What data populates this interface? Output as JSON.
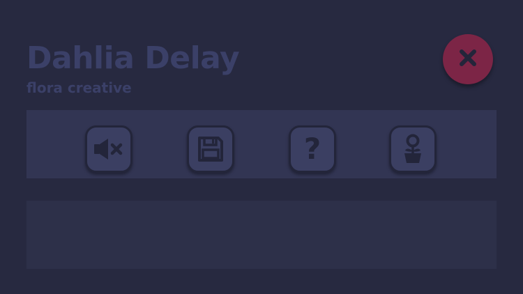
{
  "header": {
    "title": "Dahlia Delay",
    "subtitle": "flora creative"
  },
  "close_button": {
    "icon": "close-icon",
    "label": "close"
  },
  "toolbar": {
    "buttons": [
      {
        "name": "mute-button",
        "icon": "speaker-muted-icon"
      },
      {
        "name": "save-button",
        "icon": "floppy-disk-icon"
      },
      {
        "name": "help-button",
        "icon": "question-mark-icon",
        "glyph": "?"
      },
      {
        "name": "flower-button",
        "icon": "potted-flower-icon"
      }
    ]
  },
  "colors": {
    "background": "#272940",
    "text_muted": "#3b4068",
    "close_accent": "#7c2546",
    "toolbar_panel": "#323553",
    "button_fill": "#3b3f62",
    "icon_dark": "#23253a",
    "content_panel": "#2d3049"
  }
}
